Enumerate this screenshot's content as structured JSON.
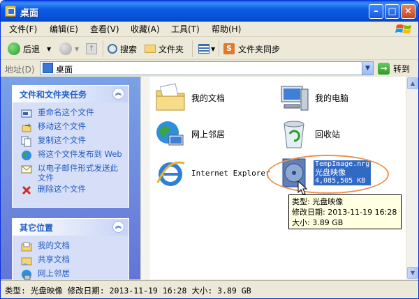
{
  "window": {
    "title": "桌面",
    "min": "–",
    "max": "□",
    "close": "✕"
  },
  "menu": [
    {
      "label": "文件(F)"
    },
    {
      "label": "编辑(E)"
    },
    {
      "label": "查看(V)"
    },
    {
      "label": "收藏(A)"
    },
    {
      "label": "工具(T)"
    },
    {
      "label": "帮助(H)"
    }
  ],
  "toolbar": {
    "back": "后退",
    "search": "搜索",
    "folders": "文件夹",
    "sync": "文件夹同步"
  },
  "address": {
    "label": "地址(D)",
    "value": "桌面",
    "go": "转到"
  },
  "tasks_panel": {
    "title": "文件和文件夹任务",
    "items": [
      {
        "label": "重命名这个文件"
      },
      {
        "label": "移动这个文件"
      },
      {
        "label": "复制这个文件"
      },
      {
        "label": "将这个文件发布到 Web"
      },
      {
        "label": "以电子邮件形式发送此文件"
      },
      {
        "label": "删除这个文件"
      }
    ]
  },
  "places_panel": {
    "title": "其它位置",
    "items": [
      {
        "label": "我的文档"
      },
      {
        "label": "共享文档"
      },
      {
        "label": "网上邻居"
      }
    ]
  },
  "desktop_items": [
    {
      "label": "我的文档"
    },
    {
      "label": "我的电脑"
    },
    {
      "label": "网上邻居"
    },
    {
      "label": "回收站"
    },
    {
      "label": "Internet Explorer"
    }
  ],
  "selected_file": {
    "name": "TempImage.nrg",
    "type": "光盘映像",
    "size": "4,085,505 KB"
  },
  "tooltip": {
    "line1": "类型: 光盘映像",
    "line2": "修改日期: 2013-11-19 16:28",
    "line3": "大小: 3.89 GB"
  },
  "status": {
    "text": "类型: 光盘映像 修改日期: 2013-11-19 16:28 大小: 3.89 GB"
  }
}
